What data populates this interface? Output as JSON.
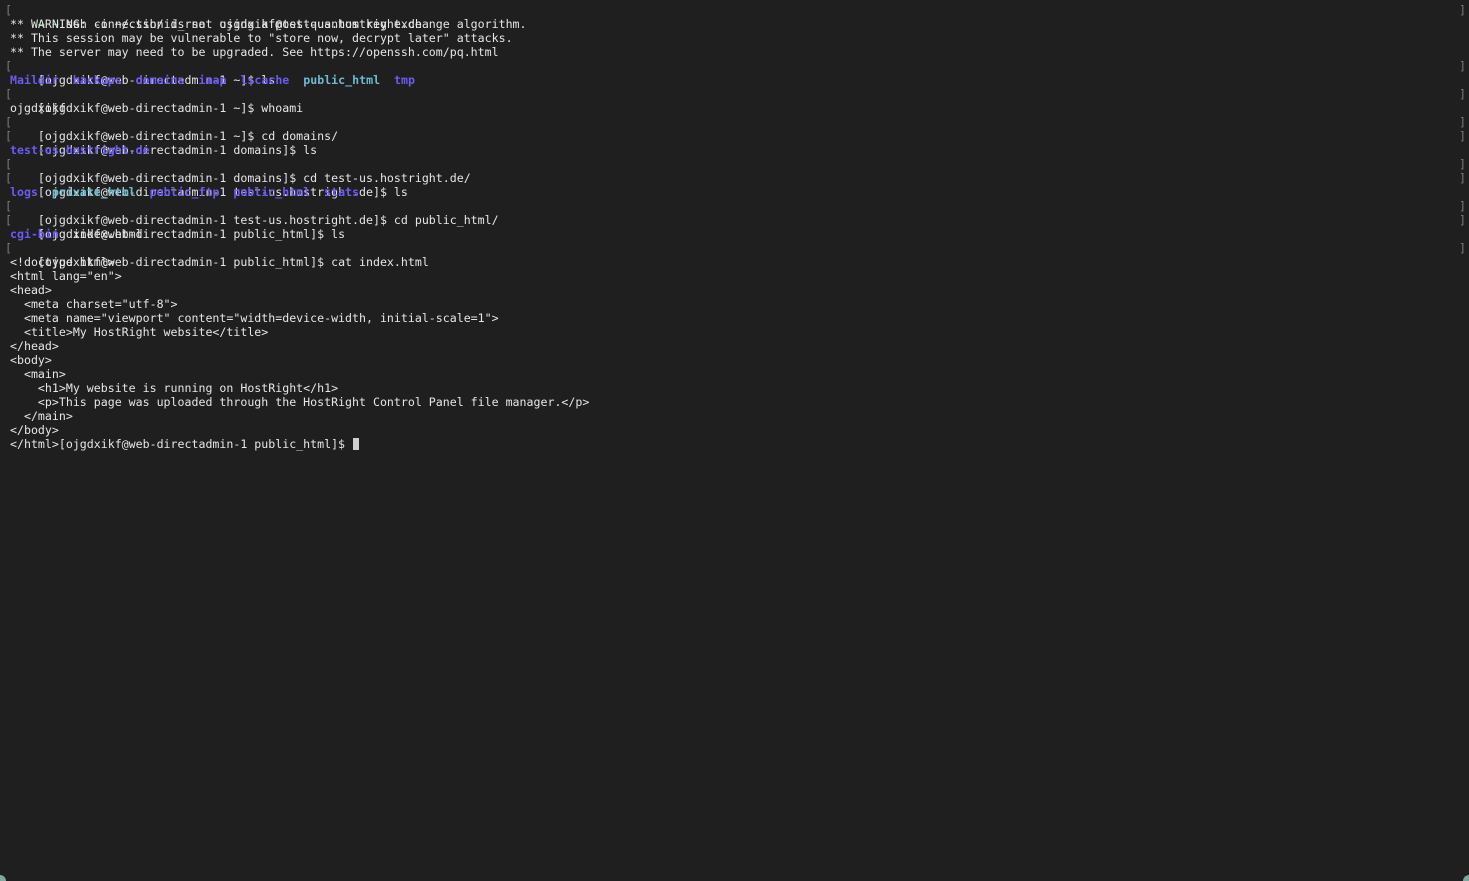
{
  "terminal": {
    "ssh_arrow": "→",
    "ssh_tilde": "~",
    "ssh_command": " ssh -i ~/.ssh/id_rsa  ojgdxikf@test-us.hostright.de",
    "warning_1": "** WARNING: connection is not using a post-quantum key exchange algorithm.",
    "warning_2": "** This session may be vulnerable to \"store now, decrypt later\" attacks.",
    "warning_3": "** The server may need to be upgraded. See https://openssh.com/pq.html",
    "prompt_ls_home": "[ojgdxikf@web-directadmin-1 ~]$ ls",
    "ls_home": [
      "Maildir",
      "backups",
      "domains",
      "imap",
      "lscache",
      "public_html",
      "tmp"
    ],
    "prompt_whoami": "[ojgdxikf@web-directadmin-1 ~]$ whoami",
    "whoami_output": "ojgdxikf",
    "prompt_cd_domains": "[ojgdxikf@web-directadmin-1 ~]$ cd domains/",
    "prompt_ls_domains": "[ojgdxikf@web-directadmin-1 domains]$ ls",
    "ls_domains": [
      "test-us.hostright.de"
    ],
    "prompt_cd_site": "[ojgdxikf@web-directadmin-1 domains]$ cd test-us.hostright.de/",
    "prompt_ls_site": "[ojgdxikf@web-directadmin-1 test-us.hostright.de]$ ls",
    "ls_site": [
      "logs",
      "private_html",
      "public_ftp",
      "public_html",
      "stats"
    ],
    "prompt_cd_public": "[ojgdxikf@web-directadmin-1 test-us.hostright.de]$ cd public_html/",
    "prompt_ls_public": "[ojgdxikf@web-directadmin-1 public_html]$ ls",
    "ls_public_dir": "cgi-bin",
    "ls_public_file": "index.html",
    "prompt_cat": "[ojgdxikf@web-directadmin-1 public_html]$ cat index.html",
    "html_lines": [
      "<!doctype html>",
      "<html lang=\"en\">",
      "<head>",
      "  <meta charset=\"utf-8\">",
      "  <meta name=\"viewport\" content=\"width=device-width, initial-scale=1\">",
      "  <title>My HostRight website</title>",
      "</head>",
      "<body>",
      "  <main>",
      "    <h1>My website is running on HostRight</h1>",
      "    <p>This page was uploaded through the HostRight Control Panel file manager.</p>",
      "  </main>",
      "</body>"
    ],
    "final_prompt": "</html>[ojgdxikf@web-directadmin-1 public_html]$ ",
    "left_mark": "[",
    "right_mark": "]"
  },
  "colors": {
    "background": "#1f1f1f",
    "text": "#e6e6e6",
    "directory": "#6a5cf2",
    "public_directory": "#6fb9d0",
    "arrow": "#4ec94e"
  }
}
